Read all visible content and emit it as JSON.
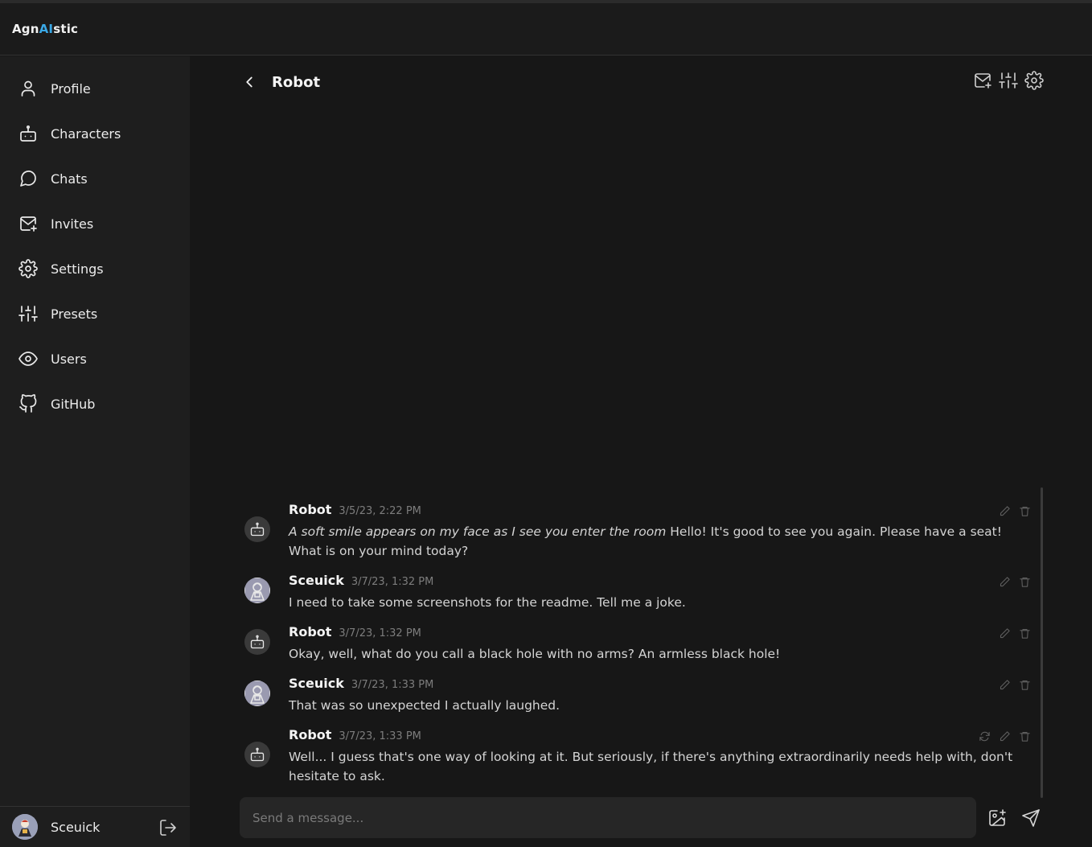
{
  "app": {
    "name_part1": "Agn",
    "name_part2": "AI",
    "name_part3": "stic",
    "accent_color": "#3aa8e6"
  },
  "sidebar": {
    "items": [
      {
        "label": "Profile",
        "icon": "user-icon"
      },
      {
        "label": "Characters",
        "icon": "bot-icon"
      },
      {
        "label": "Chats",
        "icon": "message-circle-icon"
      },
      {
        "label": "Invites",
        "icon": "mail-plus-icon"
      },
      {
        "label": "Settings",
        "icon": "gear-icon"
      },
      {
        "label": "Presets",
        "icon": "sliders-icon"
      },
      {
        "label": "Users",
        "icon": "eye-icon"
      },
      {
        "label": "GitHub",
        "icon": "github-icon"
      }
    ],
    "user": {
      "name": "Sceuick"
    }
  },
  "chat": {
    "title": "Robot",
    "header_icons": [
      "mail-plus-icon",
      "sliders-icon",
      "gear-icon"
    ],
    "messages": [
      {
        "name": "Robot",
        "time": "3/5/23, 2:22 PM",
        "action": "A soft smile appears on my face as I see you enter the room",
        "text": " Hello! It's good to see you again. Please have a seat! What is on your mind today?"
      },
      {
        "name": "Sceuick",
        "time": "3/7/23, 1:32 PM",
        "text": "I need to take some screenshots for the readme. Tell me a joke."
      },
      {
        "name": "Robot",
        "time": "3/7/23, 1:32 PM",
        "text": "Okay, well, what do you call a black hole with no arms? An armless black hole!"
      },
      {
        "name": "Sceuick",
        "time": "3/7/23, 1:33 PM",
        "text": "That was so unexpected I actually laughed."
      },
      {
        "name": "Robot",
        "time": "3/7/23, 1:33 PM",
        "text": "Well... I guess that's one way of looking at it. But seriously, if there's anything extraordinarily needs help with, don't hesitate to ask."
      }
    ],
    "composer": {
      "placeholder": "Send a message..."
    }
  }
}
